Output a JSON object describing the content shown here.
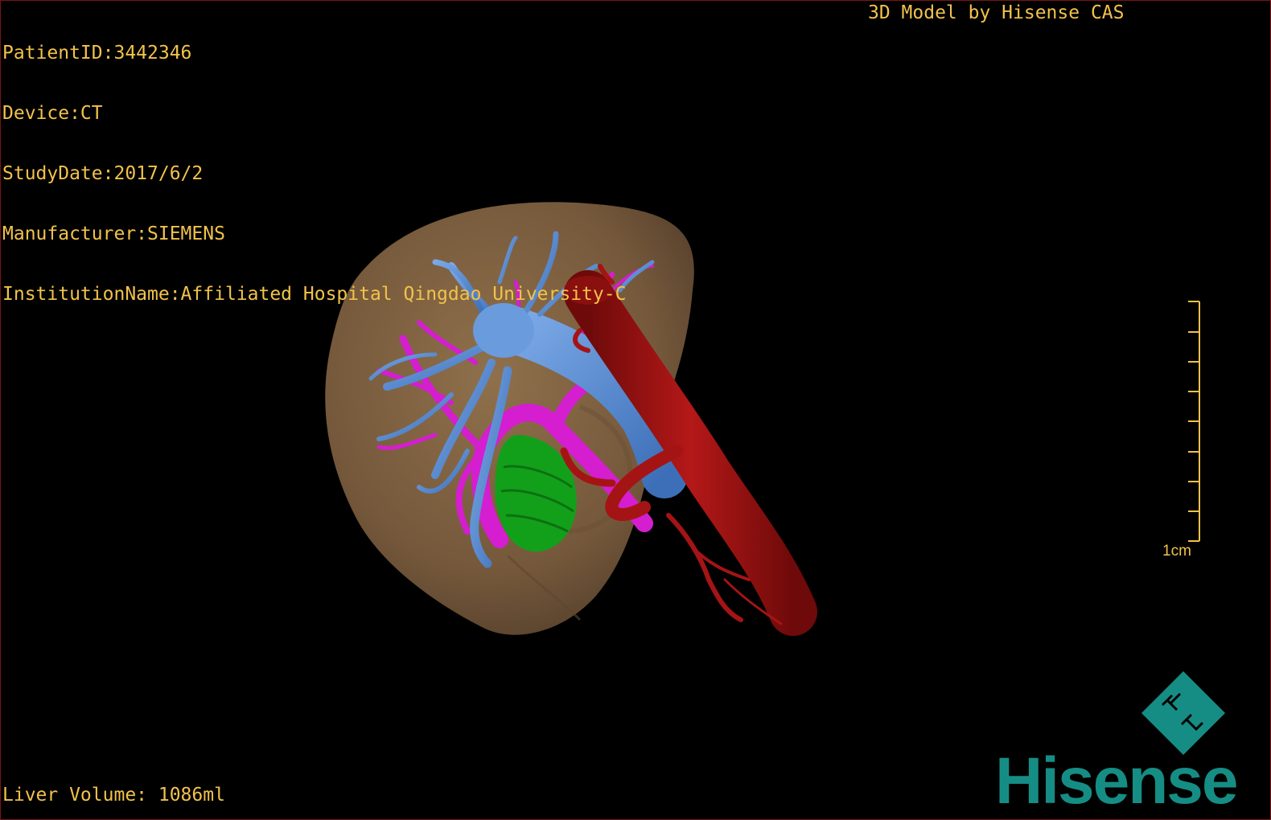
{
  "header": {
    "patient_id": "PatientID:3442346",
    "device": "Device:CT",
    "study_date": "StudyDate:2017/6/2",
    "manufacturer": "Manufacturer:SIEMENS",
    "institution": "InstitutionName:Affiliated Hospital Qingdao University-C"
  },
  "model_credit": "3D Model by Hisense CAS",
  "scale_bar": {
    "label": "1cm",
    "color": "#f2c24a"
  },
  "footer": {
    "liver_volume": "Liver Volume: 1086ml"
  },
  "brand": {
    "name": "Hisense",
    "color": "#168d84"
  },
  "colors": {
    "background": "#000000",
    "overlay_text": "#f2c24a",
    "liver": "#8a6a45",
    "hepatic_vein": "#5b8fd4",
    "portal_vein": "#d41ecf",
    "artery": "#9b1212",
    "tumor": "#12a01a"
  }
}
